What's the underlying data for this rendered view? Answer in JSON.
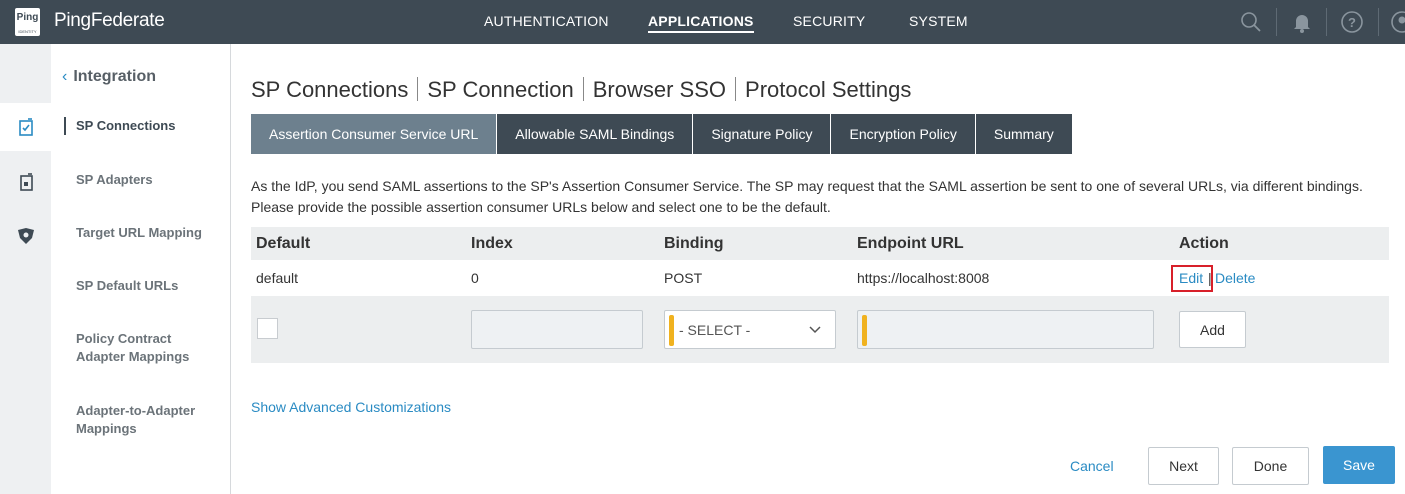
{
  "app": {
    "logo_text": "Ping",
    "logo_subtext": "IDENTITY",
    "brand": "PingFederate",
    "nav": [
      {
        "label": "AUTHENTICATION"
      },
      {
        "label": "APPLICATIONS"
      },
      {
        "label": "SECURITY"
      },
      {
        "label": "SYSTEM"
      }
    ],
    "active_nav": "APPLICATIONS",
    "icons": [
      "search-icon",
      "bell-icon",
      "help-icon",
      "user-icon"
    ]
  },
  "rail": {
    "items": [
      "sp-connection-icon",
      "sp-adapter-icon",
      "policy-icon"
    ]
  },
  "sidebar": {
    "back_label": "Integration",
    "items": [
      {
        "label": "SP Connections"
      },
      {
        "label": "SP Adapters"
      },
      {
        "label": "Target URL Mapping"
      },
      {
        "label": "SP Default URLs"
      },
      {
        "label": "Policy Contract Adapter Mappings"
      },
      {
        "label": "Adapter-to-Adapter Mappings"
      }
    ]
  },
  "breadcrumb": [
    "SP Connections",
    "SP Connection",
    "Browser SSO",
    "Protocol Settings"
  ],
  "tabs": [
    {
      "label": "Assertion Consumer Service URL"
    },
    {
      "label": "Allowable SAML Bindings"
    },
    {
      "label": "Signature Policy"
    },
    {
      "label": "Encryption Policy"
    },
    {
      "label": "Summary"
    }
  ],
  "description": "As the IdP, you send SAML assertions to the SP's Assertion Consumer Service. The SP may request that the SAML assertion be sent to one of several URLs, via different bindings. Please provide the possible assertion consumer URLs below and select one to be the default.",
  "table": {
    "headers": [
      "Default",
      "Index",
      "Binding",
      "Endpoint URL",
      "Action"
    ],
    "rows": [
      {
        "default": "default",
        "index": "0",
        "binding": "POST",
        "endpoint": "https://localhost:8008",
        "edit": "Edit",
        "delete": "Delete"
      }
    ],
    "new_row": {
      "index_value": "",
      "binding_selected": "- SELECT -",
      "endpoint_value": "",
      "add_label": "Add"
    }
  },
  "advanced_link": "Show Advanced Customizations",
  "footer": {
    "cancel": "Cancel",
    "next": "Next",
    "done": "Done",
    "save": "Save"
  },
  "colors": {
    "topbar": "#3e4a54",
    "active_tab": "#6d808e",
    "link": "#2a8bc3",
    "primary": "#3a95d0",
    "required": "#f0b21f",
    "highlight": "#d8202a"
  }
}
